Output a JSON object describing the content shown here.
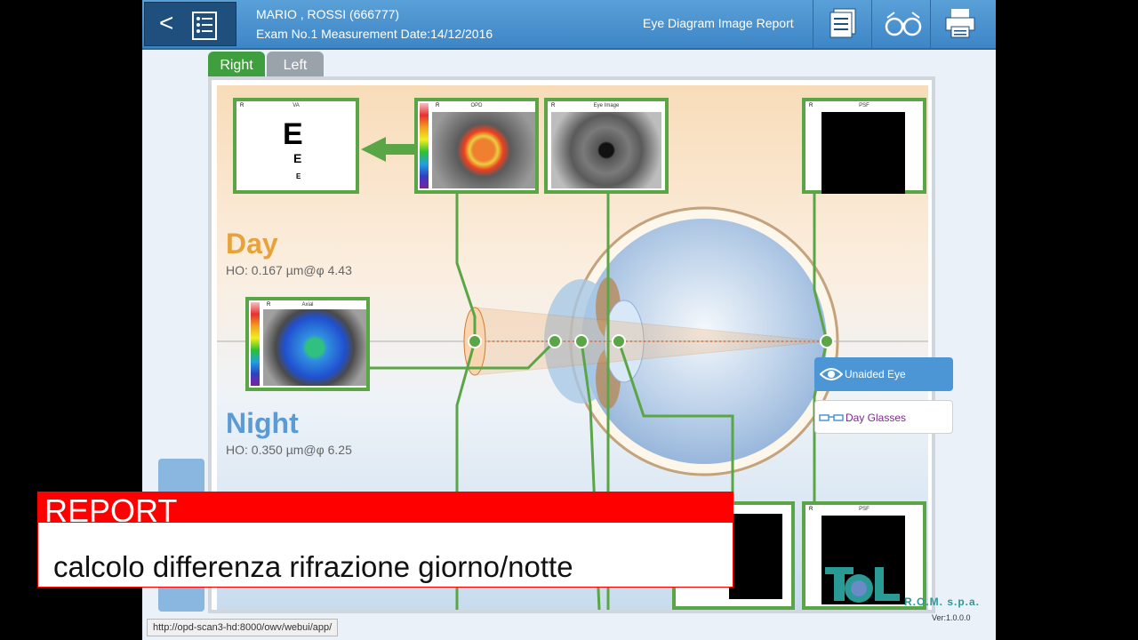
{
  "header": {
    "patient_name": "MARIO , ROSSI (666777)",
    "exam_line": "Exam No.1 Measurement Date:14/12/2016",
    "report_title": "Eye Diagram Image Report"
  },
  "toolbar": {
    "back_label": "<",
    "icons": [
      "back-icon",
      "patient-list-icon",
      "report-stack-icon",
      "glasses-icon",
      "print-icon"
    ]
  },
  "tabs": {
    "right": "Right",
    "left": "Left",
    "active": "Right"
  },
  "day": {
    "label": "Day",
    "ho": "HO: 0.167 µm@φ 4.43"
  },
  "night": {
    "label": "Night",
    "ho": "HO: 0.350 µm@φ 6.25"
  },
  "thumbnails": {
    "va": {
      "title": "VA",
      "eye": "R",
      "letter": "E"
    },
    "opd": {
      "title": "OPD",
      "eye": "R"
    },
    "eye_image": {
      "title": "Eye Image",
      "eye": "R"
    },
    "psf_top": {
      "title": "PSF",
      "eye": "R"
    },
    "axial": {
      "title": "Axial",
      "eye": "R"
    },
    "psf_bottom": {
      "title": "PSF",
      "eye": "R"
    }
  },
  "modes": {
    "unaided": "Unaided Eye",
    "glasses": "Day Glasses"
  },
  "banner": {
    "title": "REPORT",
    "subtitle": "calcolo differenza rifrazione giorno/notte"
  },
  "status_url": "http://opd-scan3-hd:8000/owv/webui/app/",
  "brand": {
    "name": "R.O.M. s.p.a.",
    "version": "Ver:1.0.0.0"
  },
  "colors": {
    "accent_green": "#5aa646",
    "header_blue": "#3d86c6",
    "day_orange": "#e8a23c",
    "night_blue": "#5a9bd6",
    "banner_red": "#ff0000"
  }
}
